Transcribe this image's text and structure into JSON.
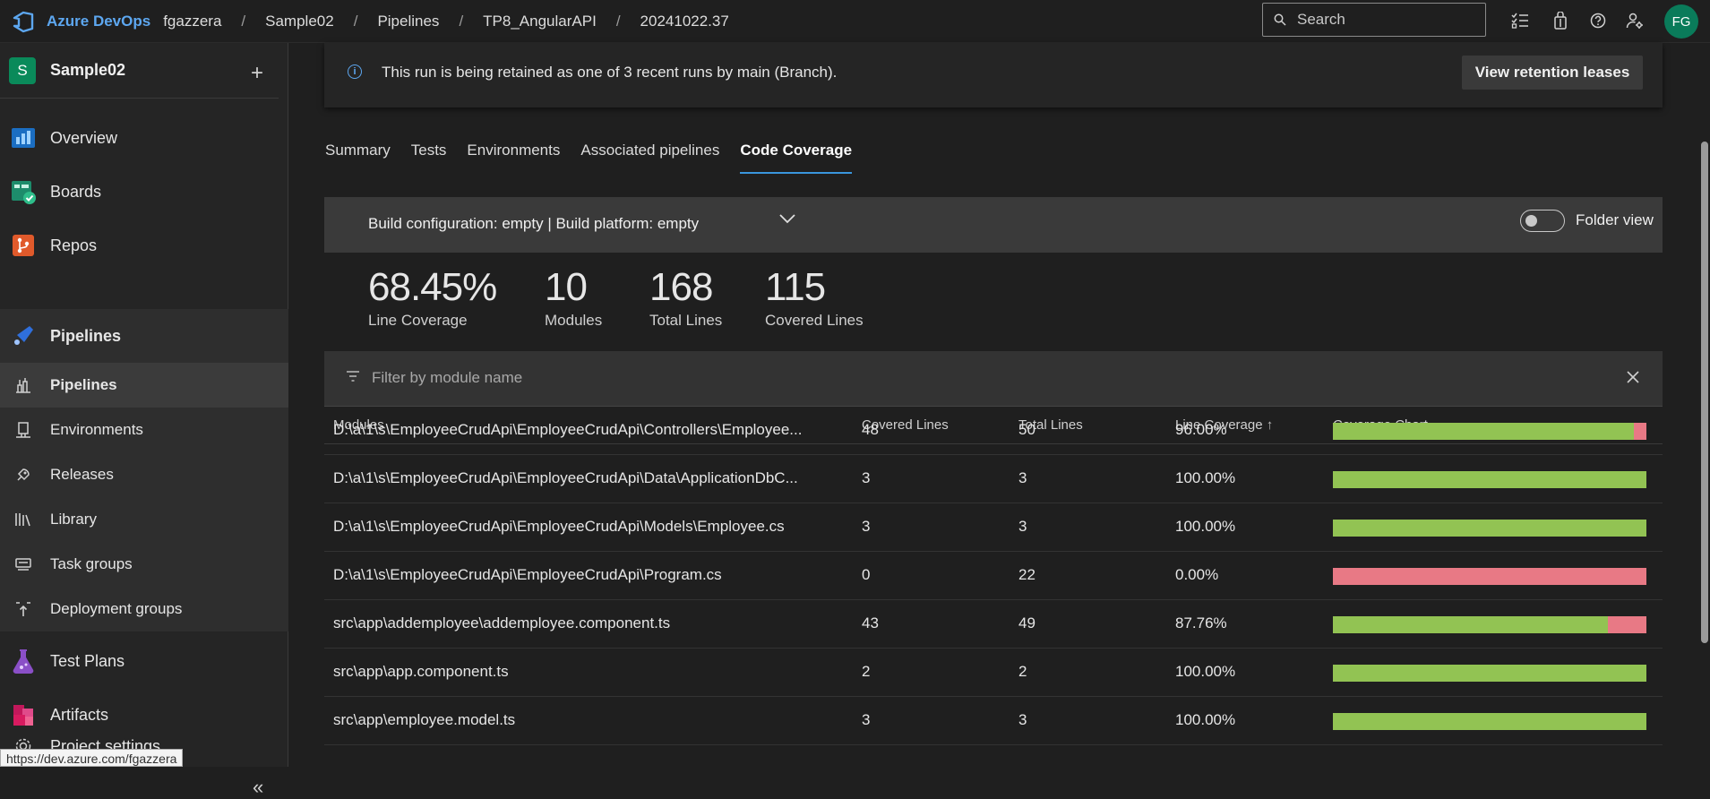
{
  "topbar": {
    "brand": "Azure DevOps",
    "breadcrumbs": [
      "fgazzera",
      "Sample02",
      "Pipelines",
      "TP8_AngularAPI",
      "20241022.37"
    ],
    "search_placeholder": "Search",
    "avatar_initials": "FG"
  },
  "sidebar": {
    "project_initial": "S",
    "project_name": "Sample02",
    "items": [
      {
        "label": "Overview",
        "icon": "overview-icon"
      },
      {
        "label": "Boards",
        "icon": "boards-icon"
      },
      {
        "label": "Repos",
        "icon": "repos-icon"
      },
      {
        "label": "Pipelines",
        "icon": "pipelines-icon"
      },
      {
        "label": "Pipelines",
        "icon": "pipelines-sub-icon"
      },
      {
        "label": "Environments",
        "icon": "environments-icon"
      },
      {
        "label": "Releases",
        "icon": "releases-icon"
      },
      {
        "label": "Library",
        "icon": "library-icon"
      },
      {
        "label": "Task groups",
        "icon": "task-groups-icon"
      },
      {
        "label": "Deployment groups",
        "icon": "deployment-groups-icon"
      },
      {
        "label": "Test Plans",
        "icon": "test-plans-icon"
      },
      {
        "label": "Artifacts",
        "icon": "artifacts-icon"
      }
    ],
    "project_settings": "Project settings",
    "status_url": "https://dev.azure.com/fgazzera"
  },
  "banner": {
    "text": "This run is being retained as one of 3 recent runs by main (Branch).",
    "button": "View retention leases"
  },
  "tabs": [
    "Summary",
    "Tests",
    "Environments",
    "Associated pipelines",
    "Code Coverage"
  ],
  "active_tab": "Code Coverage",
  "config": {
    "text": "Build configuration: empty | Build platform: empty",
    "folder_view": "Folder view",
    "folder_view_on": false
  },
  "stats": [
    {
      "value": "68.45%",
      "label": "Line Coverage"
    },
    {
      "value": "10",
      "label": "Modules"
    },
    {
      "value": "168",
      "label": "Total Lines"
    },
    {
      "value": "115",
      "label": "Covered Lines"
    }
  ],
  "filter": {
    "placeholder": "Filter by module name"
  },
  "table": {
    "headers": [
      "Modules",
      "Covered Lines",
      "Total Lines",
      "Line Coverage",
      "Coverage Chart"
    ],
    "sort_indicator": "↑",
    "rows": [
      {
        "module": "D:\\a\\1\\s\\EmployeeCrudApi\\EmployeeCrudApi\\Controllers\\Employee...",
        "covered": "48",
        "total": "50",
        "coverage": "96.00%",
        "fraction": 0.96
      },
      {
        "module": "D:\\a\\1\\s\\EmployeeCrudApi\\EmployeeCrudApi\\Data\\ApplicationDbC...",
        "covered": "3",
        "total": "3",
        "coverage": "100.00%",
        "fraction": 1.0
      },
      {
        "module": "D:\\a\\1\\s\\EmployeeCrudApi\\EmployeeCrudApi\\Models\\Employee.cs",
        "covered": "3",
        "total": "3",
        "coverage": "100.00%",
        "fraction": 1.0
      },
      {
        "module": "D:\\a\\1\\s\\EmployeeCrudApi\\EmployeeCrudApi\\Program.cs",
        "covered": "0",
        "total": "22",
        "coverage": "0.00%",
        "fraction": 0.0
      },
      {
        "module": "src\\app\\addemployee\\addemployee.component.ts",
        "covered": "43",
        "total": "49",
        "coverage": "87.76%",
        "fraction": 0.8776
      },
      {
        "module": "src\\app\\app.component.ts",
        "covered": "2",
        "total": "2",
        "coverage": "100.00%",
        "fraction": 1.0
      },
      {
        "module": "src\\app\\employee.model.ts",
        "covered": "3",
        "total": "3",
        "coverage": "100.00%",
        "fraction": 1.0
      }
    ]
  },
  "colors": {
    "covered": "#92c353",
    "uncovered": "#e87985",
    "accent": "#3a96dd"
  }
}
